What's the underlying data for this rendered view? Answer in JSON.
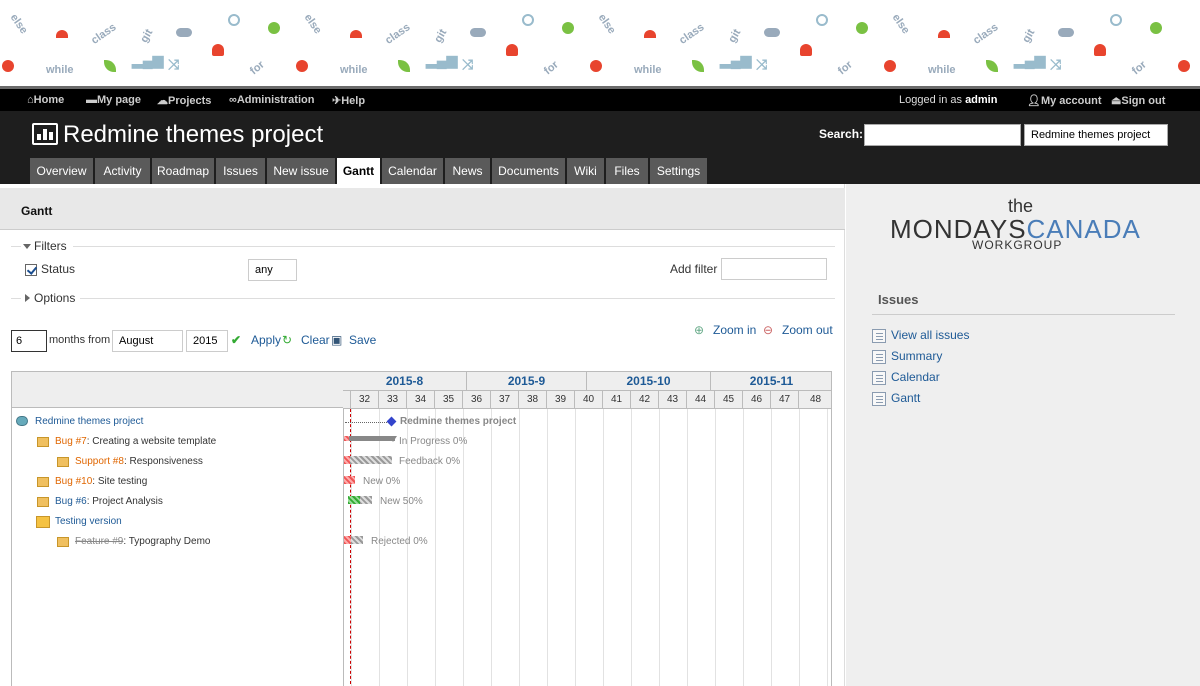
{
  "pattern": {
    "words": [
      "else",
      "class",
      "git",
      "while",
      "for"
    ]
  },
  "top_menu": {
    "home": "Home",
    "my_page": "My page",
    "projects": "Projects",
    "administration": "Administration",
    "help": "Help",
    "logged_in_prefix": "Logged in as",
    "user": "admin",
    "my_account": "My account",
    "sign_out": "Sign out"
  },
  "header": {
    "title": "Redmine themes project",
    "search_label": "Search:",
    "search_value": "",
    "project_jump": "Redmine themes project"
  },
  "tabs": [
    {
      "label": "Overview"
    },
    {
      "label": "Activity"
    },
    {
      "label": "Roadmap"
    },
    {
      "label": "Issues"
    },
    {
      "label": "New issue"
    },
    {
      "label": "Gantt",
      "selected": true
    },
    {
      "label": "Calendar"
    },
    {
      "label": "News"
    },
    {
      "label": "Documents"
    },
    {
      "label": "Wiki"
    },
    {
      "label": "Files"
    },
    {
      "label": "Settings"
    }
  ],
  "content": {
    "title": "Gantt",
    "filters_label": "Filters",
    "status_label": "Status",
    "status_value": "any",
    "add_filter_label": "Add filter",
    "options_label": "Options",
    "months_value": "6",
    "months_from_label": "months from",
    "month_value": "August",
    "year_value": "2015",
    "apply": "Apply",
    "clear": "Clear",
    "save": "Save",
    "zoom_in": "Zoom in",
    "zoom_out": "Zoom out"
  },
  "gantt": {
    "months": [
      "2015-8",
      "2015-9",
      "2015-10",
      "2015-11"
    ],
    "weeks": [
      "32",
      "33",
      "34",
      "35",
      "36",
      "37",
      "38",
      "39",
      "40",
      "41",
      "42",
      "43",
      "44",
      "45",
      "46",
      "47",
      "48"
    ],
    "rows": {
      "project": {
        "name": "Redmine themes project",
        "label": "Redmine themes project"
      },
      "bug7": {
        "ref": "Bug #7",
        "subject": ": Creating a website template",
        "status": "In Progress 0%"
      },
      "support8": {
        "ref": "Support #8",
        "subject": ": Responsiveness",
        "status": "Feedback 0%"
      },
      "bug10": {
        "ref": "Bug #10",
        "subject": ": Site testing",
        "status": "New 0%"
      },
      "bug6": {
        "ref": "Bug #6",
        "subject": ": Project Analysis",
        "status": "New 50%"
      },
      "version": {
        "name": "Testing version"
      },
      "feature9": {
        "ref": "Feature #9",
        "subject": ": Typography Demo",
        "status": "Rejected 0%"
      }
    }
  },
  "sidebar": {
    "logo_the": "the",
    "logo_mondays": "MONDAYS",
    "logo_canada": "CANADA",
    "logo_workgroup": "WORKGROUP",
    "issues_title": "Issues",
    "links": [
      "View all issues",
      "Summary",
      "Calendar",
      "Gantt"
    ]
  },
  "colors": {
    "link": "#1e5a96",
    "header_bg": "#1e1e1e",
    "tab_bg": "#5a5a5a",
    "orange_link": "#e06600"
  }
}
